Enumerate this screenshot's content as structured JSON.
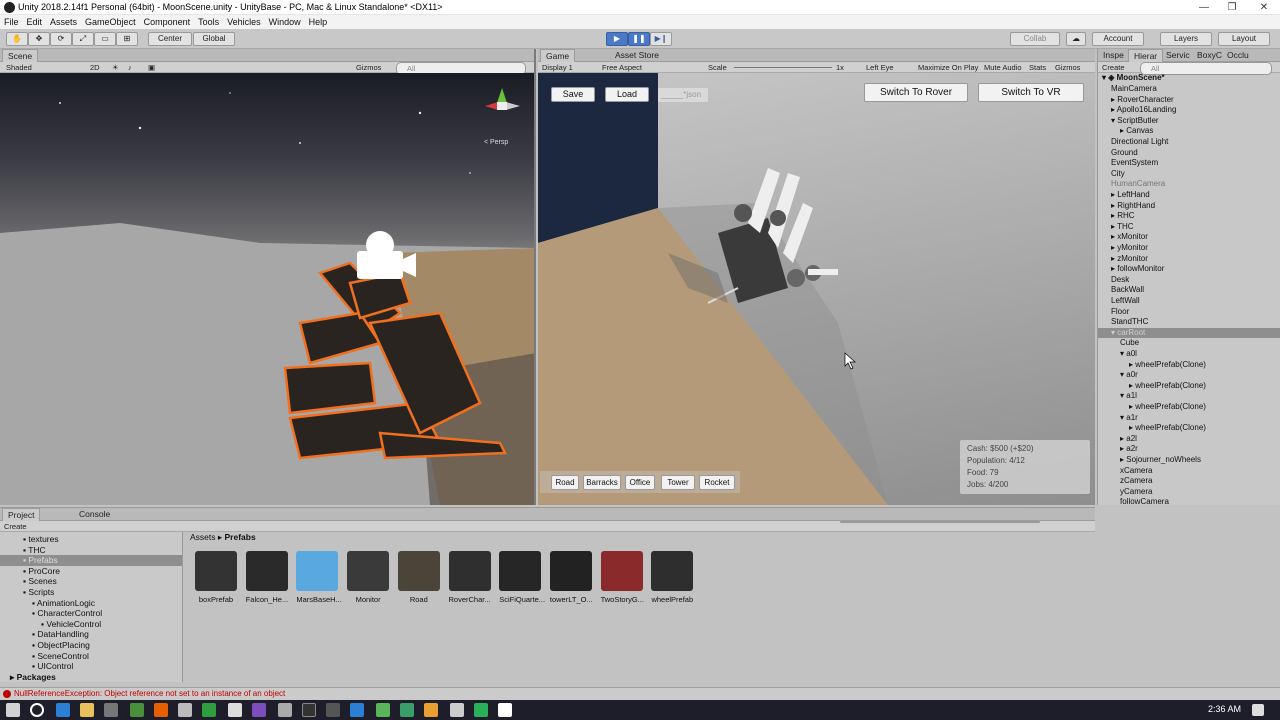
{
  "window": {
    "title": "Unity 2018.2.14f1 Personal (64bit) - MoonScene.unity - UnityBase - PC, Mac & Linux Standalone* <DX11>"
  },
  "menu": [
    "File",
    "Edit",
    "Assets",
    "GameObject",
    "Component",
    "Tools",
    "Vehicles",
    "Window",
    "Help"
  ],
  "toolbar": {
    "center": "Center",
    "global": "Global",
    "collab": "Collab",
    "account": "Account",
    "layers": "Layers",
    "layout": "Layout"
  },
  "scene": {
    "tab": "Scene",
    "asset_store_tab": "Asset Store",
    "shading": "Shaded",
    "mode2d": "2D",
    "gizmos": "Gizmos",
    "search": "All",
    "persp": "< Persp"
  },
  "game": {
    "tab": "Game",
    "display": "Display 1",
    "aspect": "Free Aspect",
    "scale_label": "Scale",
    "scale_value": "1x",
    "left_eye": "Left Eye",
    "maximize": "Maximize On Play",
    "mute": "Mute Audio",
    "stats": "Stats",
    "gizmos": "Gizmos",
    "save": "Save",
    "load": "Load",
    "file_input": "_____*json",
    "switch_rover": "Switch To Rover",
    "switch_vr": "Switch To VR",
    "build_buttons": [
      "Road",
      "Barracks",
      "Office",
      "Tower",
      "Rocket"
    ],
    "hud": {
      "cash": "Cash: $500 (+$20)",
      "population": "Population: 4/12",
      "food": "Food: 79",
      "jobs": "Jobs: 4/200"
    }
  },
  "hierarchy": {
    "tabs": [
      "Inspe",
      "Hierar",
      "Servic",
      "BoxyC",
      "Occlu"
    ],
    "create": "Create",
    "search": "All",
    "scene": "MoonScene*",
    "items": [
      [
        "MainCamera",
        ""
      ],
      [
        "RoverCharacter",
        "▸"
      ],
      [
        "Apollo16Landing",
        "▸"
      ],
      [
        "ScriptButler",
        "▾"
      ],
      [
        "Canvas",
        "▸"
      ],
      [
        "Directional Light",
        ""
      ],
      [
        "Ground",
        ""
      ],
      [
        "EventSystem",
        ""
      ],
      [
        "City",
        ""
      ],
      [
        "HumanCamera",
        ""
      ],
      [
        "LeftHand",
        "▸"
      ],
      [
        "RightHand",
        "▸"
      ],
      [
        "RHC",
        "▸"
      ],
      [
        "THC",
        "▸"
      ],
      [
        "xMonitor",
        "▸"
      ],
      [
        "yMonitor",
        "▸"
      ],
      [
        "zMonitor",
        "▸"
      ],
      [
        "followMonitor",
        "▸"
      ],
      [
        "Desk",
        ""
      ],
      [
        "BackWall",
        ""
      ],
      [
        "LeftWall",
        ""
      ],
      [
        "Floor",
        ""
      ],
      [
        "StandTHC",
        ""
      ],
      [
        "carRoot",
        "▾"
      ],
      [
        "Cube",
        ""
      ],
      [
        "a0l",
        "▾"
      ],
      [
        "wheelPrefab(Clone)",
        "▸"
      ],
      [
        "a0r",
        "▾"
      ],
      [
        "wheelPrefab(Clone)",
        "▸"
      ],
      [
        "a1l",
        "▾"
      ],
      [
        "wheelPrefab(Clone)",
        "▸"
      ],
      [
        "a1r",
        "▾"
      ],
      [
        "wheelPrefab(Clone)",
        "▸"
      ],
      [
        "a2l",
        "▸"
      ],
      [
        "a2r",
        "▸"
      ],
      [
        "Sojourner_noWheels",
        "▸"
      ],
      [
        "xCamera",
        ""
      ],
      [
        "zCamera",
        ""
      ],
      [
        "yCamera",
        ""
      ],
      [
        "followCamera",
        ""
      ]
    ]
  },
  "project": {
    "tab": "Project",
    "console_tab": "Console",
    "create": "Create",
    "breadcrumb_root": "Assets",
    "breadcrumb_current": "Prefabs",
    "tree": [
      [
        "textures",
        1
      ],
      [
        "THC",
        1
      ],
      [
        "Prefabs",
        1
      ],
      [
        "ProCore",
        1
      ],
      [
        "Scenes",
        1
      ],
      [
        "Scripts",
        1
      ],
      [
        "AnimationLogic",
        2
      ],
      [
        "CharacterControl",
        2
      ],
      [
        "VehicleControl",
        3
      ],
      [
        "DataHandling",
        2
      ],
      [
        "ObjectPlacing",
        2
      ],
      [
        "SceneControl",
        2
      ],
      [
        "UIControl",
        2
      ]
    ],
    "packages": "Packages",
    "assets": [
      "boxPrefab",
      "Falcon_He...",
      "MarsBaseH...",
      "Monitor",
      "Road",
      "RoverChar...",
      "SciFiQuarte...",
      "towerLT_O...",
      "TwoStoryG...",
      "wheelPrefab"
    ]
  },
  "status": {
    "error": "NullReferenceException: Object reference not set to an instance of an object"
  },
  "taskbar": {
    "time": "2:36 AM"
  },
  "colors": {
    "accent": "#4b79c8",
    "selection": "#f07020",
    "error": "#c00000"
  }
}
